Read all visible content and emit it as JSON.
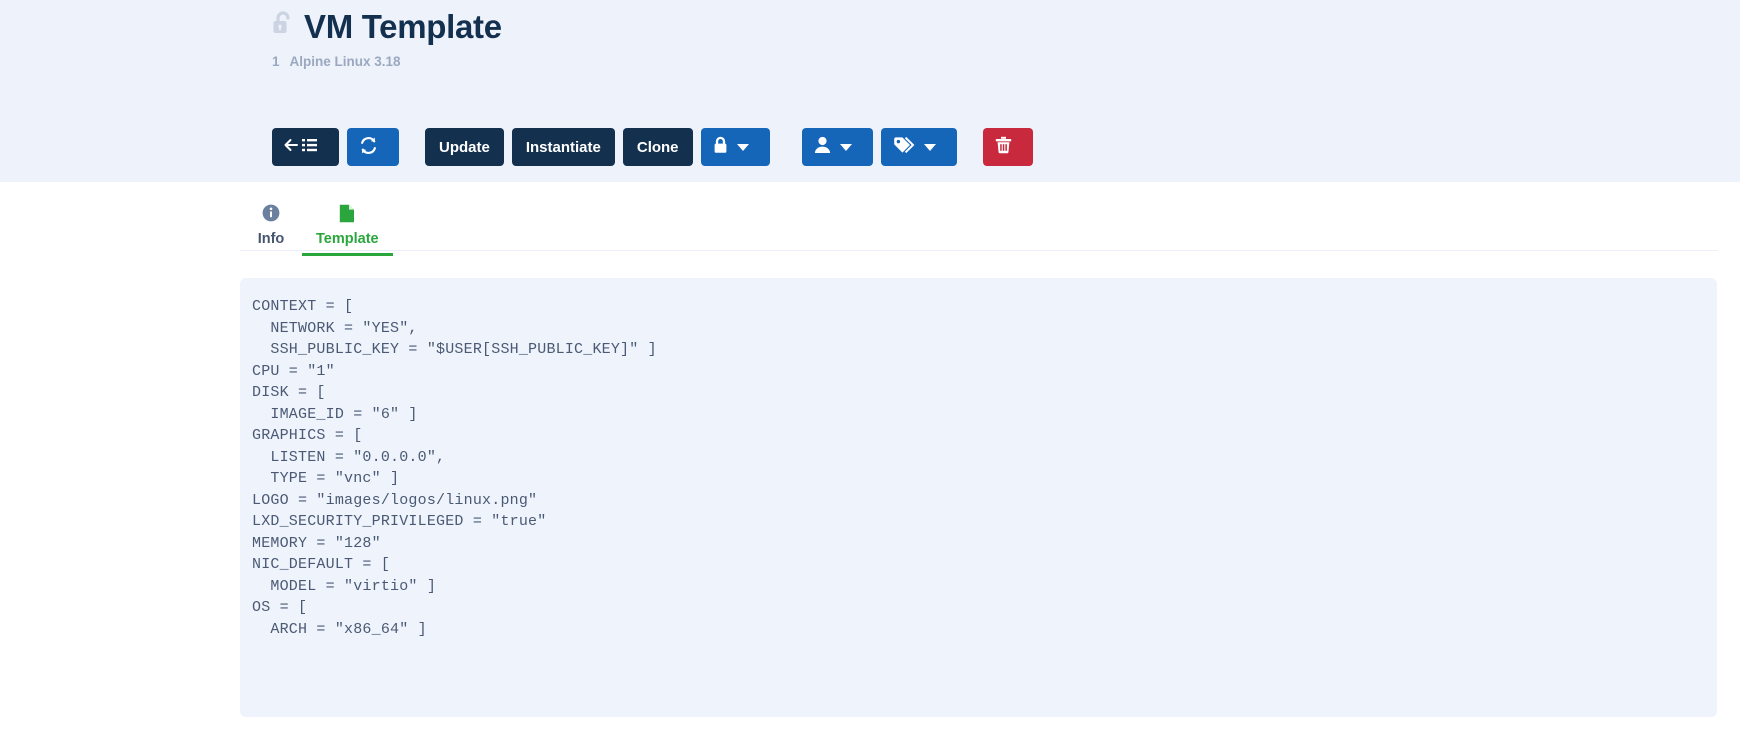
{
  "header": {
    "lock_icon": "unlocked-padlock-icon",
    "title": "VM Template",
    "id": "1",
    "os_name": "Alpine Linux 3.18"
  },
  "toolbar": {
    "back_to_list": {
      "label": "",
      "icon": "back-to-list-icon"
    },
    "refresh": {
      "label": "",
      "icon": "refresh-icon"
    },
    "update": {
      "label": "Update"
    },
    "instantiate": {
      "label": "Instantiate"
    },
    "clone": {
      "label": "Clone"
    },
    "lock": {
      "label": "",
      "icon": "lock-icon"
    },
    "ownership": {
      "label": "",
      "icon": "user-icon"
    },
    "tags": {
      "label": "",
      "icon": "tags-icon"
    },
    "delete": {
      "label": "",
      "icon": "trash-icon"
    }
  },
  "tabs": [
    {
      "label": "Info",
      "icon": "info-circle-icon",
      "active": false
    },
    {
      "label": "Template",
      "icon": "file-document-icon",
      "active": true
    }
  ],
  "template_body": "CONTEXT = [\n  NETWORK = \"YES\",\n  SSH_PUBLIC_KEY = \"$USER[SSH_PUBLIC_KEY]\" ]\nCPU = \"1\"\nDISK = [\n  IMAGE_ID = \"6\" ]\nGRAPHICS = [\n  LISTEN = \"0.0.0.0\",\n  TYPE = \"vnc\" ]\nLOGO = \"images/logos/linux.png\"\nLXD_SECURITY_PRIVILEGED = \"true\"\nMEMORY = \"128\"\nNIC_DEFAULT = [\n  MODEL = \"virtio\" ]\nOS = [\n  ARCH = \"x86_64\" ]",
  "colors": {
    "navy": "#14304f",
    "blue": "#1565b8",
    "red": "#c9293c",
    "green": "#2aa63c",
    "page_bg": "#eef2fb",
    "code_bg": "#eff3fc",
    "muted": "#9aa8c0"
  }
}
